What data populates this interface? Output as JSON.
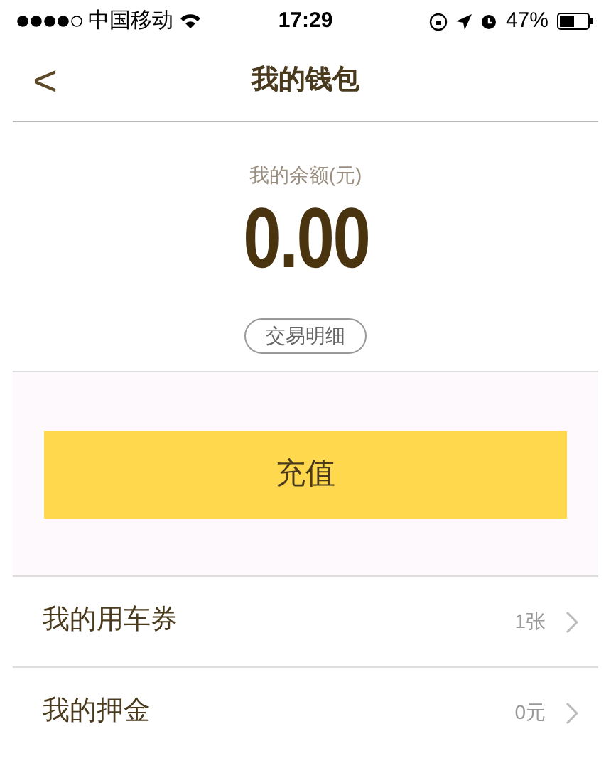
{
  "status_bar": {
    "carrier": "中国移动",
    "time": "17:29",
    "battery": "47%"
  },
  "nav": {
    "back": "<",
    "title": "我的钱包"
  },
  "balance": {
    "label": "我的余额(元)",
    "amount": "0.00",
    "details_button": "交易明细"
  },
  "recharge_button": "充值",
  "rows": [
    {
      "label": "我的用车券",
      "value": "1张"
    },
    {
      "label": "我的押金",
      "value": "0元"
    }
  ]
}
